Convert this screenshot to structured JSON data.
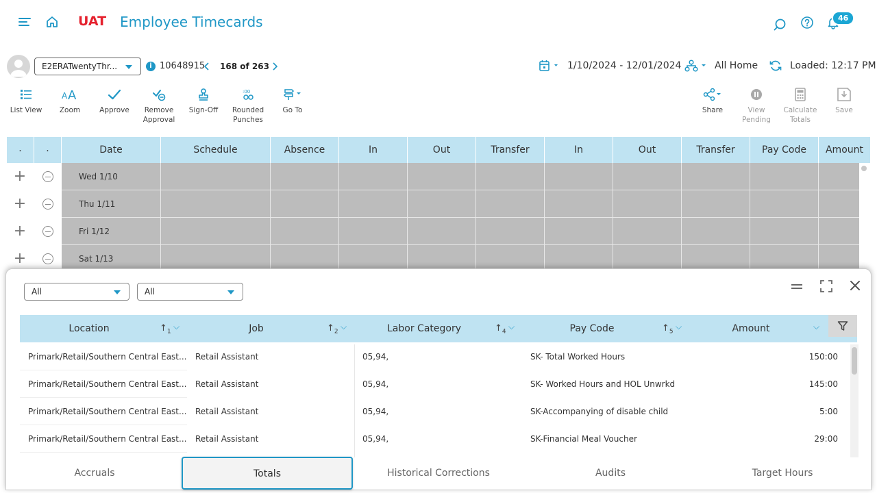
{
  "header": {
    "env": "UAT",
    "title": "Employee Timecards",
    "notification_count": "46"
  },
  "context": {
    "employee_select": "E2ERATwentyThr...",
    "employee_id": "10648915",
    "pager": "168 of 263",
    "date_range": "1/10/2024 - 12/01/2024",
    "location": "All Home",
    "loaded": "Loaded: 12:17 PM"
  },
  "toolbar": {
    "list_view": "List View",
    "zoom": "Zoom",
    "approve": "Approve",
    "remove_approval": "Remove Approval",
    "sign_off": "Sign-Off",
    "rounded_punches": "Rounded Punches",
    "go_to": "Go To",
    "share": "Share",
    "view_pending": "View Pending",
    "calculate_totals": "Calculate Totals",
    "save": "Save"
  },
  "grid": {
    "columns": [
      "Date",
      "Schedule",
      "Absence",
      "In",
      "Out",
      "Transfer",
      "In",
      "Out",
      "Transfer",
      "Pay Code",
      "Amount"
    ],
    "rows": [
      {
        "date": "Wed 1/10"
      },
      {
        "date": "Thu 1/11"
      },
      {
        "date": "Fri 1/12"
      },
      {
        "date": "Sat 1/13"
      }
    ]
  },
  "panel": {
    "filter1": "All",
    "filter2": "All",
    "columns": {
      "location": "Location",
      "job": "Job",
      "labor_category": "Labor Category",
      "pay_code": "Pay Code",
      "amount": "Amount"
    },
    "sort_indexes": {
      "location": "1",
      "job": "2",
      "labor_category": "4",
      "pay_code": "5"
    },
    "rows": [
      {
        "location": "Primark/Retail/Southern Central East...",
        "job": "Retail Assistant",
        "labor": "05,94,",
        "pay_code": "SK- Total Worked Hours",
        "amount": "150:00"
      },
      {
        "location": "Primark/Retail/Southern Central East...",
        "job": "Retail Assistant",
        "labor": "05,94,",
        "pay_code": "SK- Worked Hours and HOL Unwrkd",
        "amount": "145:00"
      },
      {
        "location": "Primark/Retail/Southern Central East...",
        "job": "Retail Assistant",
        "labor": "05,94,",
        "pay_code": "SK-Accompanying of disable child",
        "amount": "5:00"
      },
      {
        "location": "Primark/Retail/Southern Central East...",
        "job": "Retail Assistant",
        "labor": "05,94,",
        "pay_code": "SK-Financial Meal Voucher",
        "amount": "29:00"
      }
    ],
    "tabs": [
      "Accruals",
      "Totals",
      "Historical Corrections",
      "Audits",
      "Target Hours"
    ],
    "active_tab": "Totals"
  },
  "colors": {
    "accent": "#1f97c6",
    "env": "#e5212e",
    "header_bg": "#bfe3f2",
    "row_gray": "#bcbcbc"
  }
}
